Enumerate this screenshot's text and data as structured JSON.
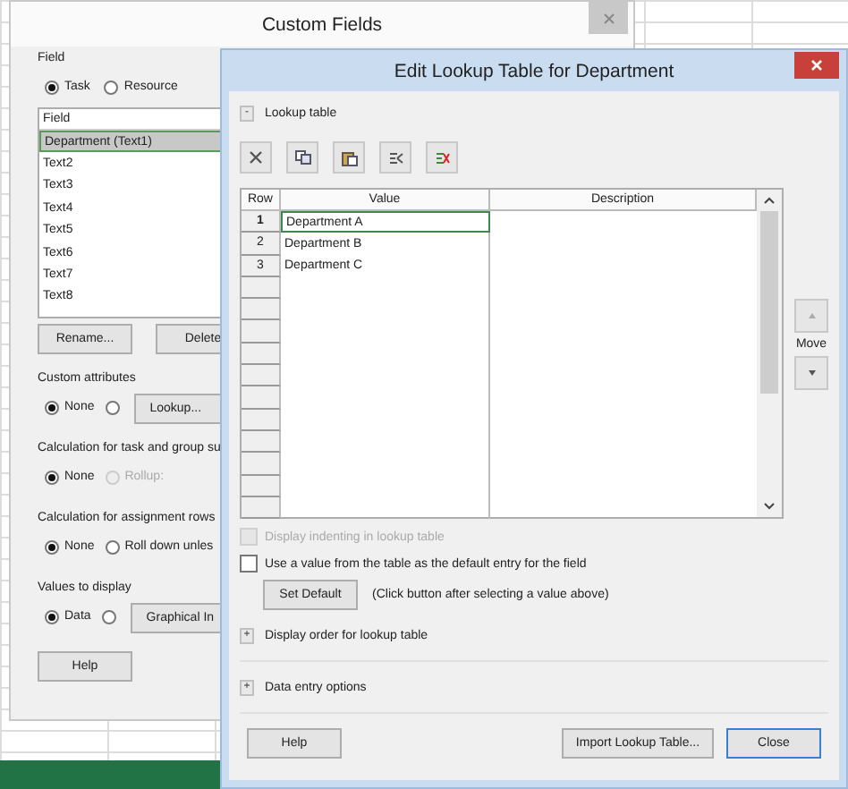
{
  "back_window": {
    "title": "Custom Fields",
    "field_label": "Field",
    "type_options": [
      {
        "label": "Task",
        "selected": true
      },
      {
        "label": "Resource",
        "selected": false
      }
    ],
    "field_list": {
      "header": "Field",
      "items": [
        {
          "label": "Department (Text1)",
          "selected": true
        },
        {
          "label": "Text2",
          "selected": false
        },
        {
          "label": "Text3",
          "selected": false
        },
        {
          "label": "Text4",
          "selected": false
        },
        {
          "label": "Text5",
          "selected": false
        },
        {
          "label": "Text6",
          "selected": false
        },
        {
          "label": "Text7",
          "selected": false
        },
        {
          "label": "Text8",
          "selected": false
        }
      ]
    },
    "list_buttons": [
      "Rename...",
      "Delete"
    ],
    "sections": [
      {
        "title": "Custom attributes",
        "options": [
          {
            "label": "None",
            "selected": true,
            "disabled": false
          },
          {
            "selected": false,
            "disabled": false
          }
        ],
        "button": "Lookup..."
      },
      {
        "title": "Calculation for task and group su",
        "options": [
          {
            "label": "None",
            "selected": true,
            "disabled": false
          },
          {
            "label": "Rollup:",
            "selected": false,
            "disabled": true
          }
        ]
      },
      {
        "title": "Calculation for assignment rows",
        "options": [
          {
            "label": "None",
            "selected": true,
            "disabled": false
          },
          {
            "label": "Roll down unles",
            "selected": false,
            "disabled": false
          }
        ]
      },
      {
        "title": "Values to display",
        "options": [
          {
            "label": "Data",
            "selected": true,
            "disabled": false
          },
          {
            "selected": false,
            "disabled": false
          }
        ],
        "button": "Graphical In"
      }
    ],
    "help_button": "Help"
  },
  "front_window": {
    "title": "Edit Lookup Table for Department",
    "lookup_section": {
      "toggle": "-",
      "label": "Lookup table"
    },
    "table": {
      "columns": [
        "Row",
        "Value",
        "Description"
      ],
      "rows": [
        {
          "row": "1",
          "value": "Department A",
          "selected": true
        },
        {
          "row": "2",
          "value": "Department B",
          "selected": false
        },
        {
          "row": "3",
          "value": "Department C",
          "selected": false
        }
      ]
    },
    "move_label": "Move",
    "options": [
      {
        "label": "Display indenting in lookup table",
        "checked": false,
        "disabled": true
      },
      {
        "label": "Use a value from the table as the default entry for the field",
        "checked": false,
        "disabled": false
      }
    ],
    "set_default": {
      "button": "Set Default",
      "hint": "(Click button after selecting a value above)"
    },
    "collapsed_sections": [
      {
        "toggle": "+",
        "label": "Display order for lookup table"
      },
      {
        "toggle": "+",
        "label": "Data entry options"
      }
    ],
    "buttons": {
      "help": "Help",
      "import": "Import Lookup Table...",
      "close": "Close"
    }
  }
}
